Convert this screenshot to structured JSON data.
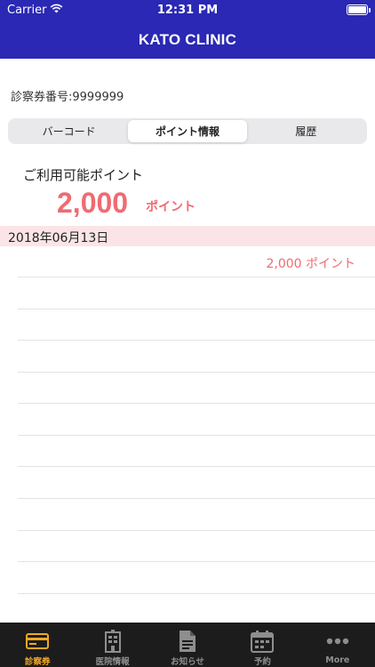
{
  "status_bar": {
    "carrier": "Carrier",
    "time": "12:31 PM"
  },
  "header": {
    "title": "KATO CLINIC",
    "color": "#2a28b4"
  },
  "card": {
    "number_label": "診察券番号:9999999"
  },
  "segments": [
    {
      "label": "バーコード",
      "active": false
    },
    {
      "label": "ポイント情報",
      "active": true
    },
    {
      "label": "履歴",
      "active": false
    }
  ],
  "points": {
    "label": "ご利用可能ポイント",
    "value": "2,000",
    "unit": "ポイント",
    "accent": "#ef6b73"
  },
  "history": [
    {
      "date": "2018年06月13日",
      "amount": "2,000 ポイント"
    }
  ],
  "tabbar": {
    "items": [
      {
        "label": "診察券",
        "icon": "card-icon",
        "active": true
      },
      {
        "label": "医院情報",
        "icon": "clinic-building-icon",
        "active": false
      },
      {
        "label": "お知らせ",
        "icon": "document-icon",
        "active": false
      },
      {
        "label": "予約",
        "icon": "calendar-icon",
        "active": false
      },
      {
        "label": "More",
        "icon": "more-dots-icon",
        "active": false
      }
    ],
    "active_color": "#f5a623"
  }
}
